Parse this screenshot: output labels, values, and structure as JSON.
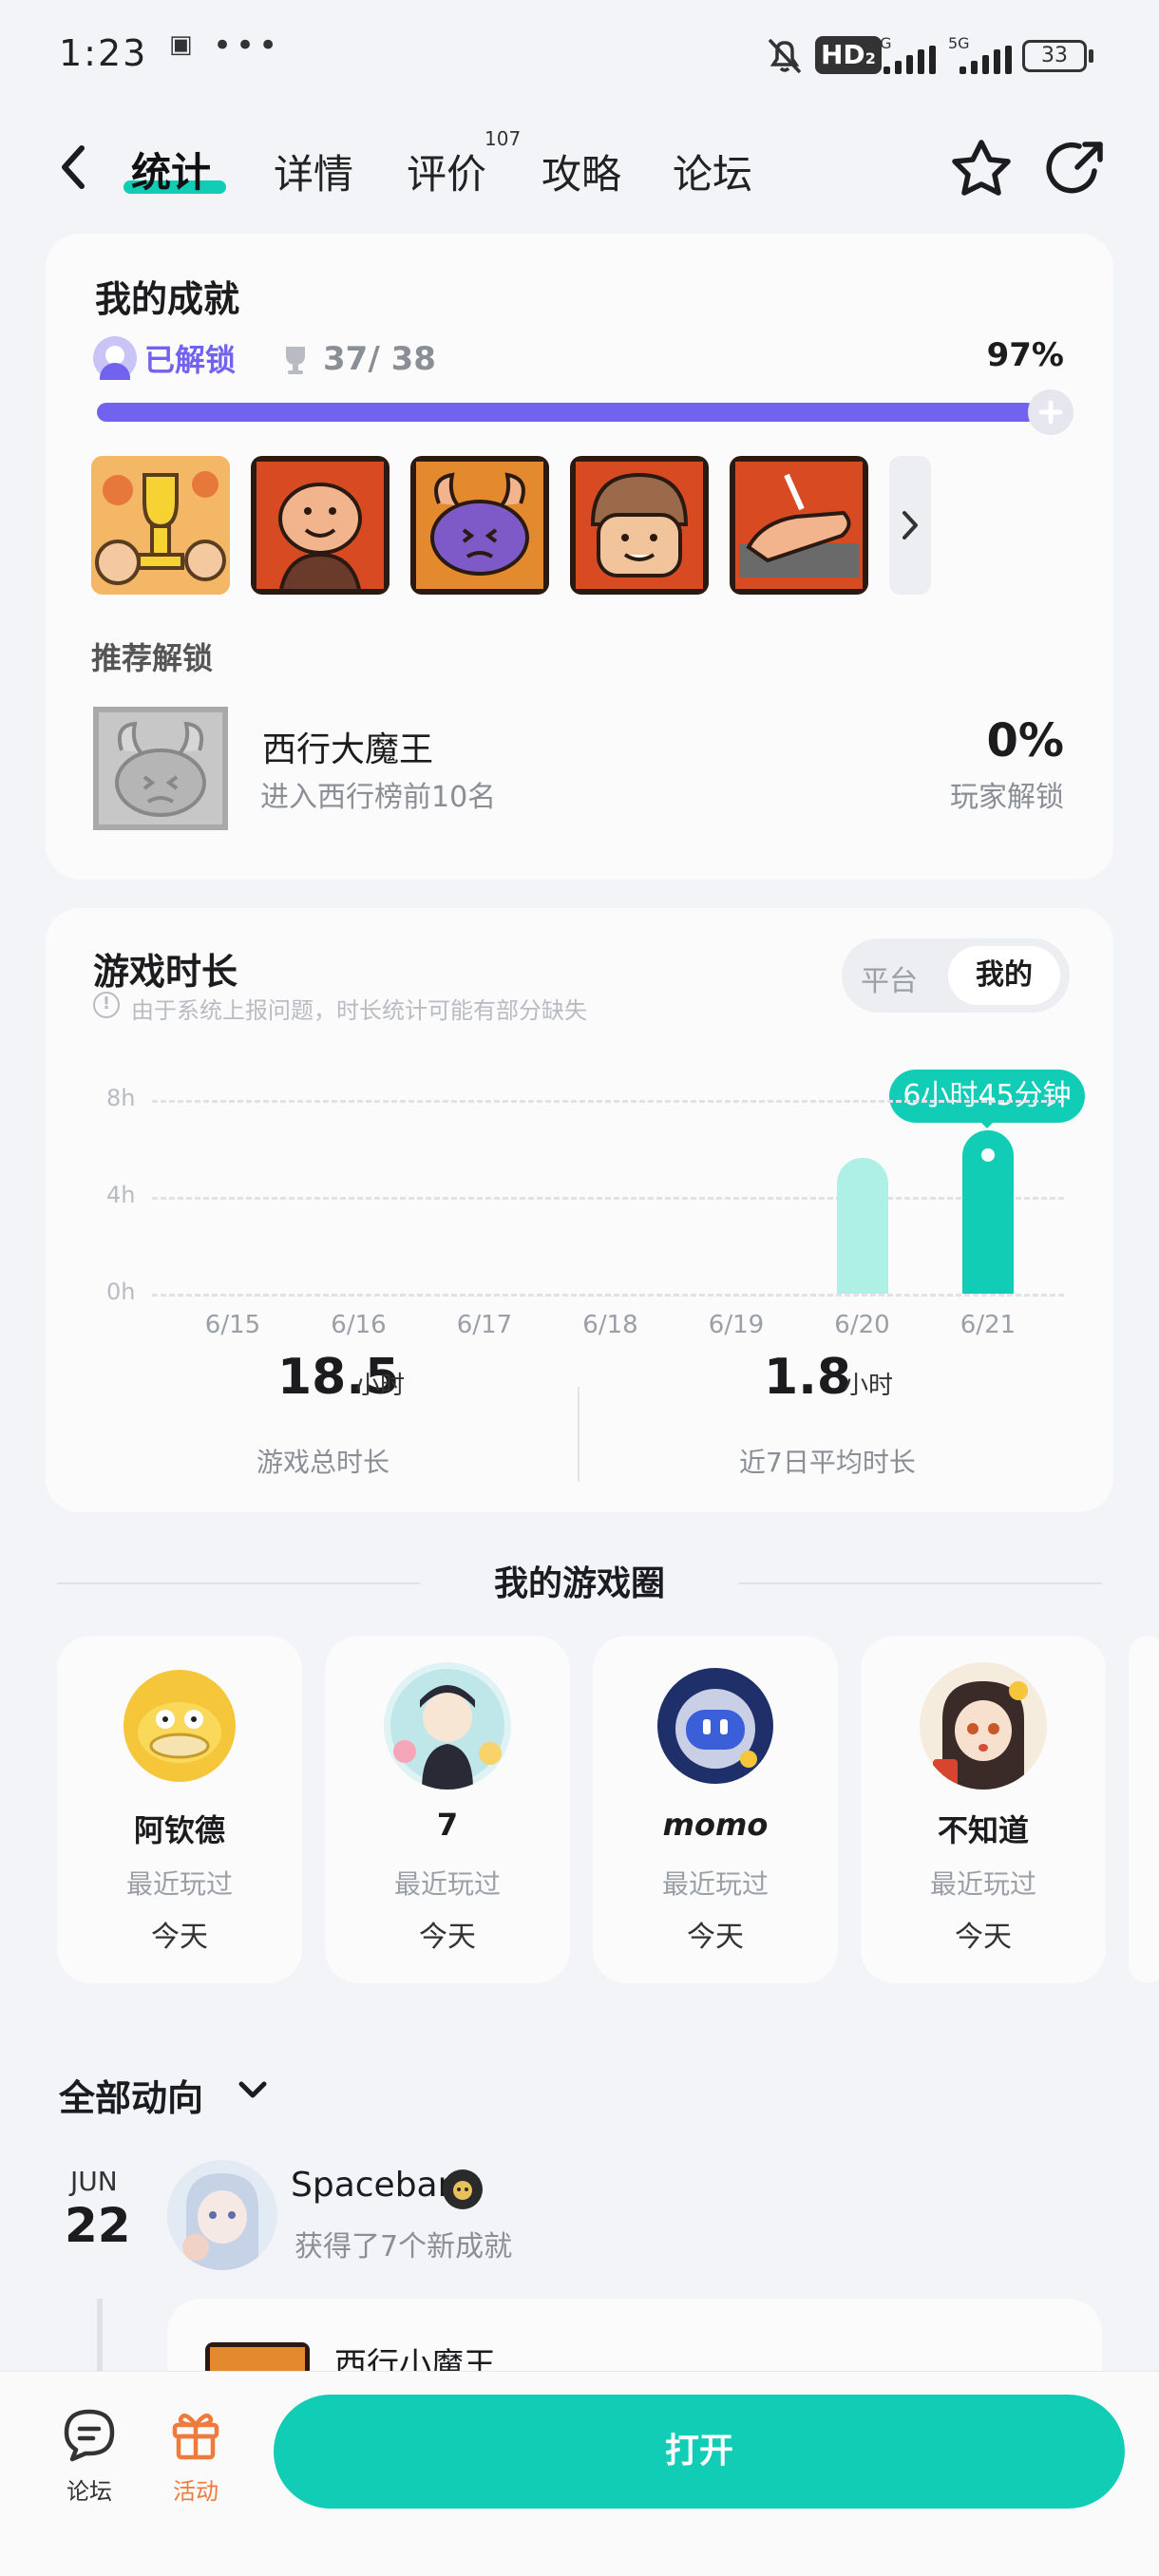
{
  "status_bar": {
    "time": "1:23",
    "dots": "• •••",
    "hd": "HD",
    "hd_sub": "2",
    "net1": "5G",
    "net2": "5G",
    "battery": "33"
  },
  "nav": {
    "tabs": [
      {
        "label": "统计"
      },
      {
        "label": "详情"
      },
      {
        "label": "评价",
        "badge": "107"
      },
      {
        "label": "攻略"
      },
      {
        "label": "论坛"
      }
    ],
    "active_tab": "统计"
  },
  "achievements": {
    "title": "我的成就",
    "unlocked_label": "已解锁",
    "count": "37/ 38",
    "percent_text": "97%",
    "progress": 0.97,
    "recommend_title": "推荐解锁",
    "recommend": {
      "name": "西行大魔王",
      "desc": "进入西行榜前10名",
      "rate": "0%",
      "rate_label": "玩家解锁"
    }
  },
  "playtime": {
    "title": "游戏时长",
    "note": "由于系统上报问题，时长统计可能有部分缺失",
    "toggle": [
      "平台",
      "我的"
    ],
    "toggle_active": "我的",
    "tooltip": "6小时45分钟",
    "total_value": "18.5",
    "total_unit": "小时",
    "total_label": "游戏总时长",
    "avg_value": "1.8",
    "avg_unit": "小时",
    "avg_label": "近7日平均时长"
  },
  "chart_data": {
    "type": "bar",
    "categories": [
      "6/15",
      "6/16",
      "6/17",
      "6/18",
      "6/19",
      "6/20",
      "6/21"
    ],
    "values": [
      0,
      0,
      0,
      0,
      0,
      5.6,
      6.75
    ],
    "yticks": [
      "8h",
      "4h",
      "0h"
    ],
    "ylim": [
      0,
      8
    ],
    "colors": {
      "highlight": "#12cdb6",
      "normal": "#aef0e6"
    }
  },
  "circle": {
    "title": "我的游戏圈",
    "friends": [
      {
        "name": "阿钦德",
        "sub": "最近玩过",
        "day": "今天"
      },
      {
        "name": "7",
        "sub": "最近玩过",
        "day": "今天"
      },
      {
        "name": "momo",
        "sub": "最近玩过",
        "day": "今天"
      },
      {
        "name": "不知道",
        "sub": "最近玩过",
        "day": "今天"
      }
    ]
  },
  "feed": {
    "filter": "全部动向",
    "month": "JUN",
    "day": "22",
    "user": "Spacebar",
    "action": "获得了7个新成就",
    "item_name": "西行小魔王"
  },
  "bottom": {
    "forum": "论坛",
    "activity": "活动",
    "open": "打开"
  },
  "colors": {
    "accent": "#12cdb6",
    "progress": "#7263ee",
    "activity": "#f07a3a"
  }
}
